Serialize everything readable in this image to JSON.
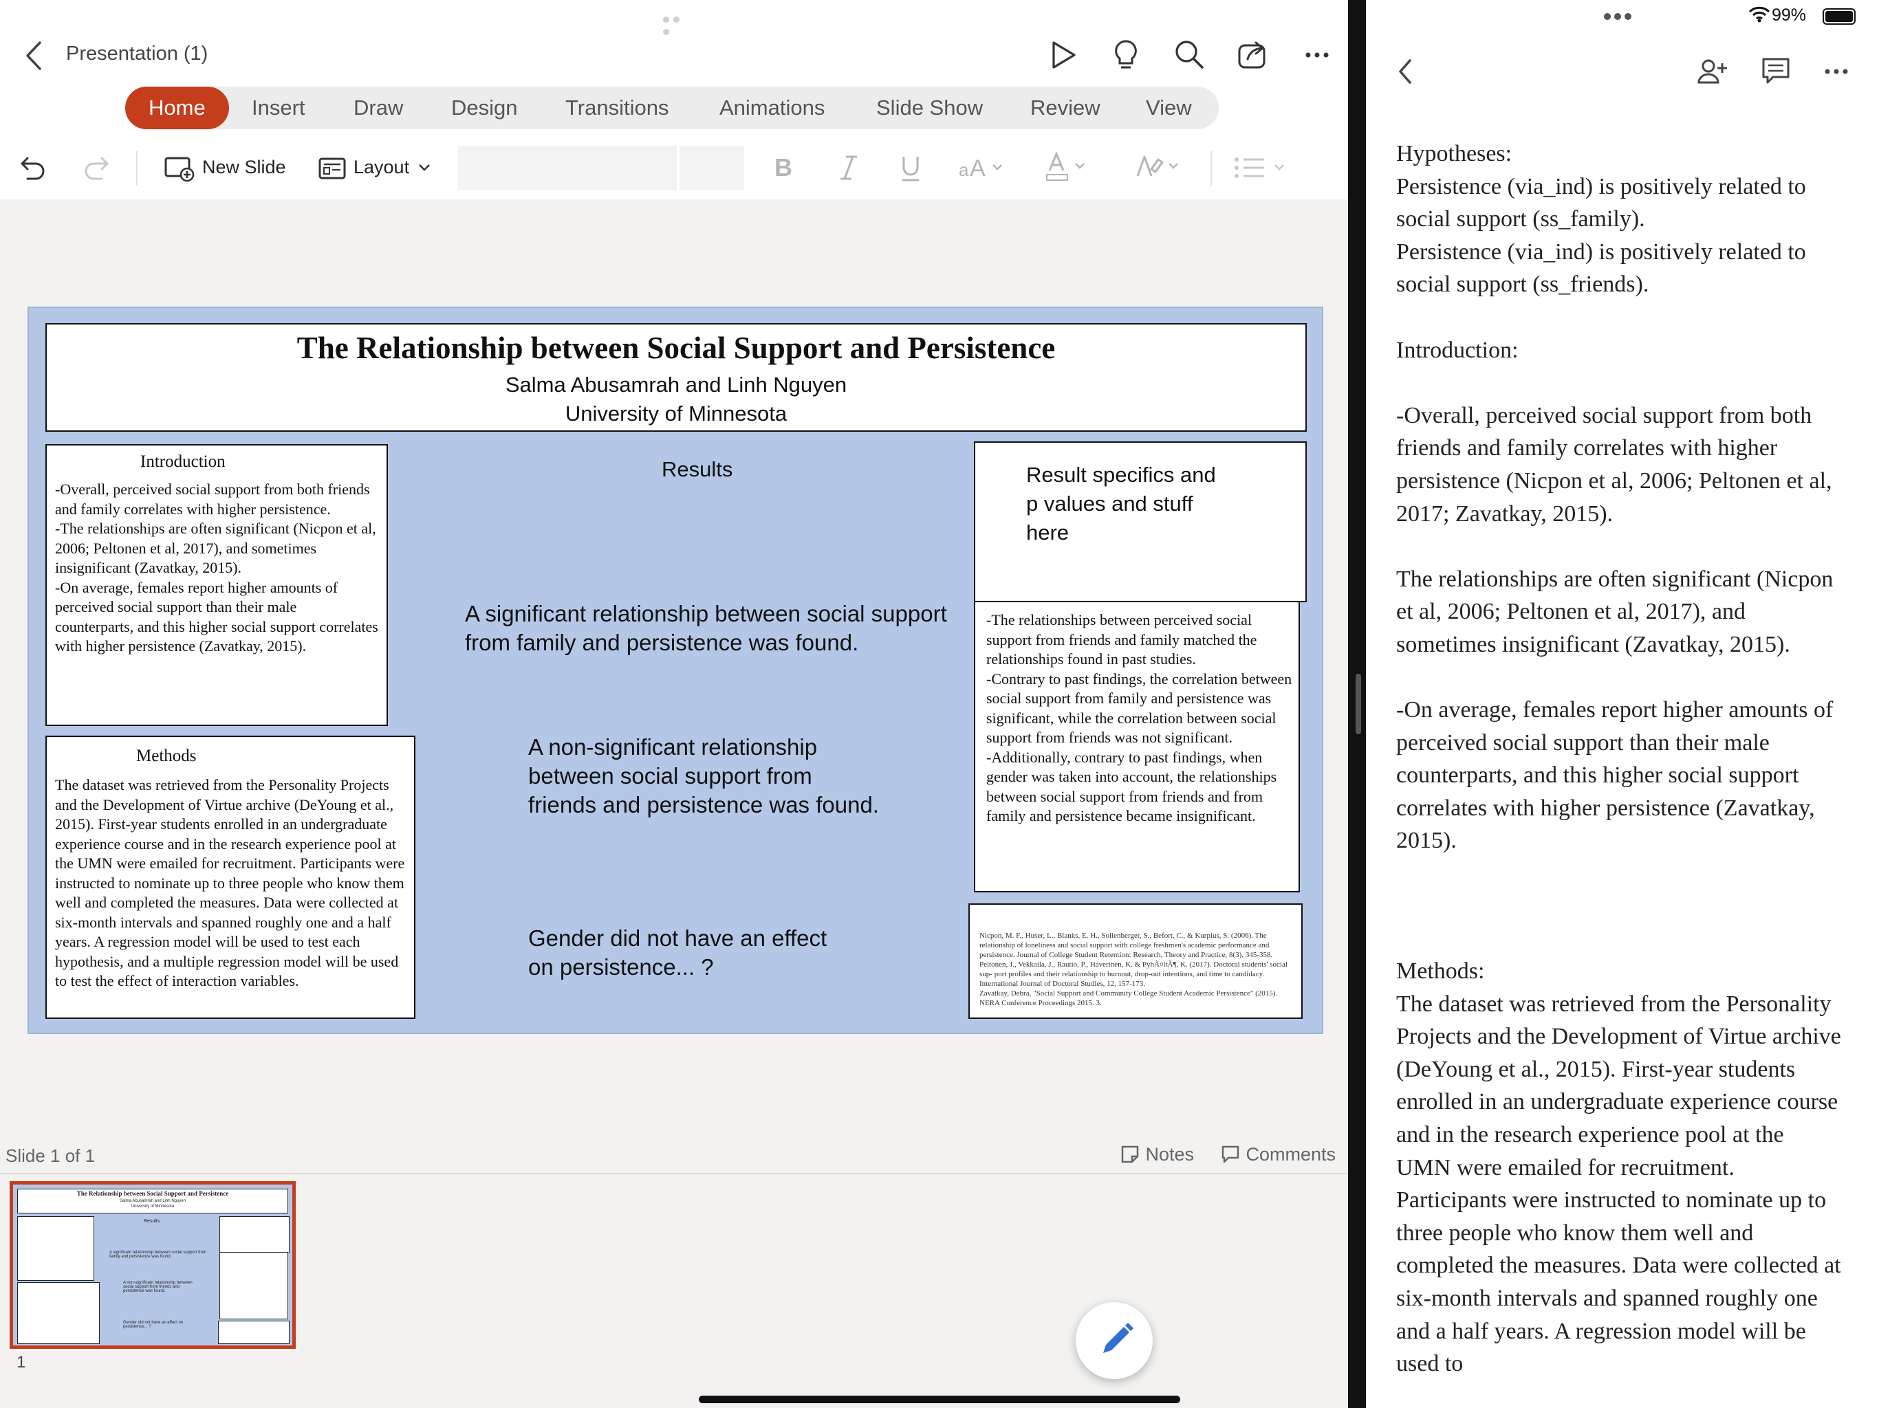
{
  "app": {
    "doc_title": "Presentation (1)",
    "tabs": [
      "Home",
      "Insert",
      "Draw",
      "Design",
      "Transitions",
      "Animations",
      "Slide Show",
      "Review",
      "View"
    ],
    "active_tab": "Home",
    "accent_color": "#c43e1c",
    "toolbar": {
      "new_slide": "New Slide",
      "layout": "Layout"
    }
  },
  "slide": {
    "title": "The Relationship between Social Support and Persistence",
    "authors": "Salma Abusamrah and Linh Nguyen",
    "university": "University of Minnesota",
    "intro_heading": "Introduction",
    "intro_body": "-Overall, perceived social support from both friends and family correlates with higher persistence.\n-The relationships are often significant (Nicpon et al, 2006; Peltonen et al, 2017), and sometimes insignificant (Zavatkay, 2015).\n-On average, females report higher amounts of perceived social support than their male counterparts, and this higher social support correlates with higher persistence (Zavatkay, 2015).",
    "methods_heading": "Methods",
    "methods_body": "The dataset was retrieved from the Personality Projects and the Development of Virtue archive (DeYoung et al., 2015). First-year students enrolled in an undergraduate experience course and in the research experience pool at the UMN were emailed for recruitment. Participants were instructed to nominate up to three people who know them well and completed the measures. Data were collected at six-month intervals and spanned roughly one and a half years. A regression model will be used to test each hypothesis, and a multiple regression model will be used to test the effect of interaction variables.",
    "results_heading": "Results",
    "result_1": "A significant relationship between social support from family and persistence was found.",
    "result_2": "A non-significant relationship between social support from friends and persistence was found.",
    "result_3": "Gender did not have an effect on persistence... ?",
    "specifics": "Result specifics and p values and stuff here",
    "discussion_body": "-The relationships between perceived social support from friends and family matched the relationships found in past studies.\n-Contrary to past findings, the correlation between social support from family and persistence was significant, while the correlation between social support from friends was not significant.\n-Additionally, contrary to past findings, when gender was taken into account, the relationships between social support from friends and from family and persistence became insignificant.",
    "references": "Nicpon, M. F., Huser, L., Blanks, E. H., Sollenberger, S., Befort, C., & Kurpius, S. (2006). The relationship of loneliness and social support with college freshmen's academic performance and persistence. Journal of College Student Retention: Research, Theory and Practice, 8(3), 345-358.\nPeltonen, J., Vekkaila, J., Rautio, P., Haverinen, K. & PyhÃ¤ltÃ¶, K. (2017). Doctoral students' social sup- port profiles and their relationship to burnout, drop-out intentions, and time to candidacy. International Journal of Doctoral Studies, 12, 157-173.\nZavatkay, Debra, \"Social Support and Community College Student Academic Persistence\" (2015). NERA Conference Proceedings 2015. 3."
  },
  "footer": {
    "slide_count": "Slide 1 of 1",
    "notes": "Notes",
    "comments": "Comments",
    "thumb_number": "1"
  },
  "status": {
    "battery": "99%"
  },
  "notes_pane": {
    "hypotheses": [
      "Hypotheses:",
      "Persistence (via_ind) is positively related to social support (ss_family).",
      "Persistence (via_ind) is positively related to social support (ss_friends)."
    ],
    "intro_label": "Introduction:",
    "intro_1": "-Overall, perceived social support from both friends and family correlates with higher persistence (Nicpon et al, 2006; Peltonen et al, 2017; Zavatkay, 2015).",
    "intro_2": "The relationships are often significant (Nicpon et al, 2006; Peltonen et al, 2017), and sometimes insignificant (Zavatkay, 2015).",
    "intro_3": "-On average, females report higher amounts of perceived social support than their male counterparts, and this higher social support correlates with higher persistence (Zavatkay, 2015).",
    "methods_label": "Methods:",
    "methods_body": "The dataset was retrieved from the Personality Projects and the Development of Virtue archive (DeYoung et al., 2015). First-year students enrolled in an undergraduate experience course and in the research experience pool at the UMN were emailed for recruitment. Participants were instructed to nominate up to three people who know them well and completed the measures. Data were collected at six-month intervals and spanned roughly one and a half years. A regression model will be used to"
  },
  "icons": [
    "back-chevron-icon",
    "play-icon",
    "lightbulb-icon",
    "search-icon",
    "share-icon",
    "more-icon",
    "undo-icon",
    "redo-icon",
    "new-slide-icon",
    "layout-icon",
    "bold-icon",
    "italic-icon",
    "underline-icon",
    "font-size-icon",
    "font-color-icon",
    "highlight-icon",
    "bullets-icon",
    "notes-icon",
    "comments-icon",
    "add-person-icon",
    "comment-icon",
    "pencil-icon",
    "wifi-icon",
    "battery-icon"
  ]
}
